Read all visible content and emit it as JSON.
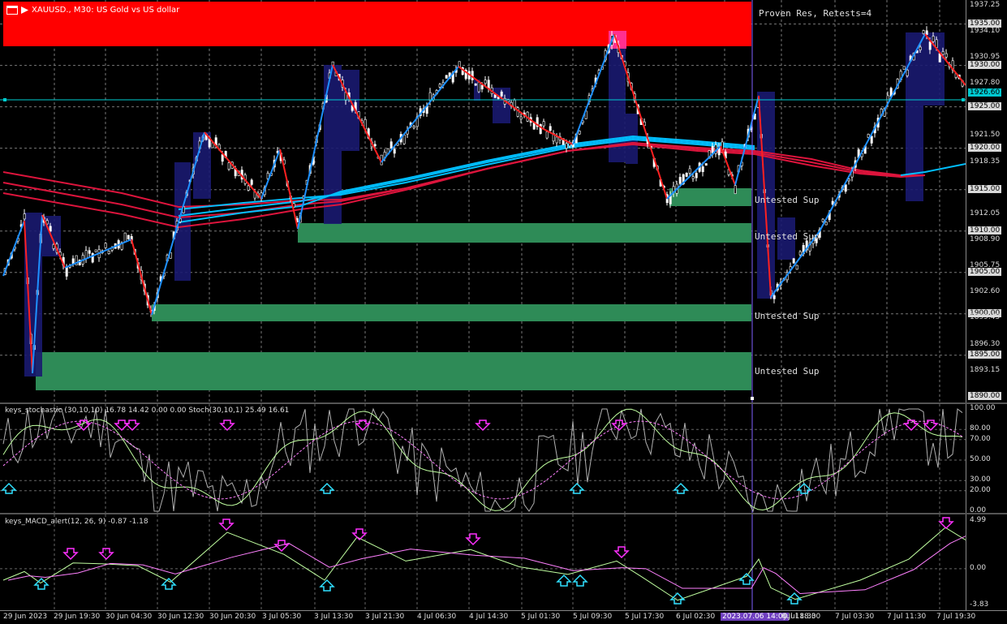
{
  "chart": {
    "symbol": "XAUUSD.",
    "timeframe": "M30",
    "description": "US Gold vs US dollar",
    "title_text": "XAUUSD., M30:  US Gold vs US dollar",
    "resistance_label": "Proven Res, Retests=4",
    "support_labels": [
      "Untested Sup",
      "Untested Sup",
      "Untested Sup",
      "Untested Sup"
    ],
    "current_price": "1926.60",
    "colors": {
      "resistance_zone": "#ff0000",
      "support_zone": "#2e8b57",
      "bull_candle": "#ffffff",
      "bear_candle": "#ffffff",
      "zigzag_up": "#1e90ff",
      "zigzag_down": "#ff2020",
      "ma_red": "#dc143c",
      "ma_cyan": "#00bfff",
      "box": "#191970",
      "current_line": "#00ced1"
    }
  },
  "price_axis": [
    "1937.25",
    "1935.00",
    "1934.10",
    "1930.95",
    "1930.00",
    "1927.80",
    "1926.60",
    "1925.00",
    "1921.50",
    "1920.00",
    "1918.35",
    "1915.00",
    "1912.05",
    "1910.00",
    "1908.90",
    "1905.75",
    "1905.00",
    "1902.60",
    "1900.00",
    "1899.45",
    "1896.30",
    "1895.00",
    "1893.15",
    "1890.00"
  ],
  "stochastic": {
    "title": "keys_stochastic (30,10,10) 16.78 14.42 0.00 0.00 Stoch(30,10,1) 25.49 16.61",
    "axis": [
      "100.00",
      "80.00",
      "70.00",
      "50.00",
      "30.00",
      "20.00",
      "0.00"
    ]
  },
  "macd": {
    "title": "keys_MACD_alert(12, 26, 9) -0.87 -1.18",
    "axis": [
      "4.99",
      "0.00",
      "-3.83"
    ]
  },
  "time_axis": [
    "29 Jun 2023",
    "29 Jun 19:30",
    "30 Jun 04:30",
    "30 Jun 12:30",
    "30 Jun 20:30",
    "3 Jul 05:30",
    "3 Jul 13:30",
    "3 Jul 21:30",
    "4 Jul 06:30",
    "4 Jul 14:30",
    "5 Jul 01:30",
    "5 Jul 09:30",
    "5 Jul 17:30",
    "6 Jul 02:30",
    "2023.07.06 14:00",
    "6 Jul 18:30",
    "7 Jul 03:30",
    "7 Jul 11:30",
    "7 Jul 19:30"
  ],
  "time_axis_partial": "Jul 18:30"
}
